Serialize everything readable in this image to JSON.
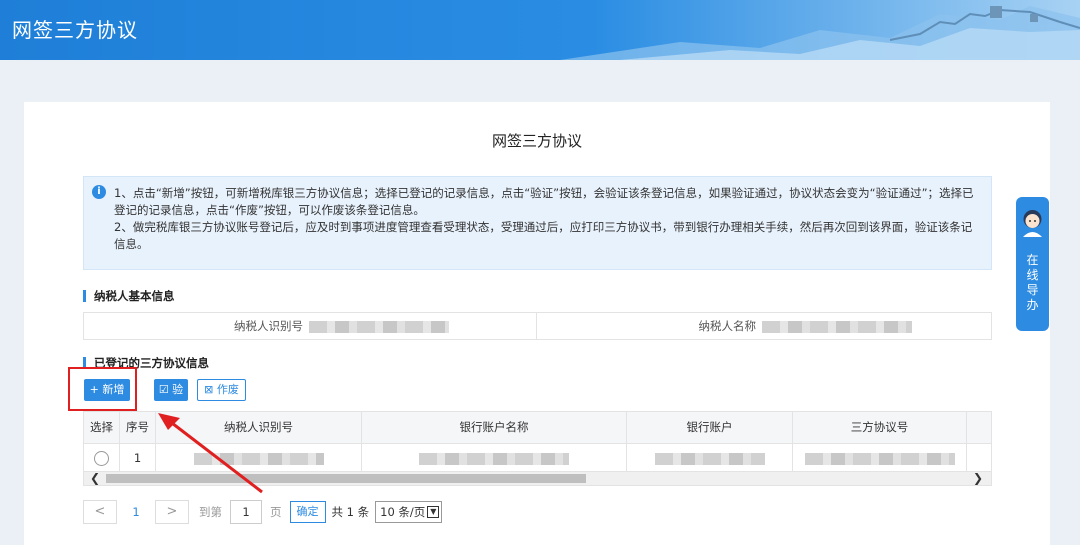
{
  "app": {
    "title": "网签三方协议"
  },
  "page": {
    "heading": "网签三方协议"
  },
  "notice": {
    "line1": "1、点击“新增”按钮，可新增税库银三方协议信息；选择已登记的记录信息，点击“验证”按钮，会验证该条登记信息，如果验证通过，协议状态会变为“验证通过”；选择已登记的记录信息，点击“作废”按钮，可以作废该条登记信息。",
    "line2": "2、做完税库银三方协议账号登记后，应及时到事项进度管理查看受理状态，受理通过后，应打印三方协议书，带到银行办理相关手续，然后再次回到该界面，验证该条记信息。"
  },
  "taxpayer": {
    "section_title": "纳税人基本信息",
    "id_label": "纳税人识别号",
    "name_label": "纳税人名称"
  },
  "agreements": {
    "section_title": "已登记的三方协议信息",
    "add_label": "+ 新增",
    "verify_label": "☑ 验证",
    "void_label": "⊠ 作废",
    "columns": [
      "选择",
      "序号",
      "纳税人识别号",
      "银行账户名称",
      "银行账户",
      "三方协议号"
    ],
    "rows": [
      {
        "index": "1"
      }
    ]
  },
  "pager": {
    "prev": "<",
    "next": ">",
    "current": "1",
    "goto_prefix": "到第",
    "goto_value": "1",
    "goto_suffix": "页",
    "confirm": "确定",
    "total": "共 1 条",
    "page_size": "10 条/页"
  },
  "side_guide": {
    "label": "在线导办"
  },
  "colors": {
    "primary": "#2d8be2",
    "highlight": "#e02020"
  },
  "icons": [
    "info-icon",
    "chevron-down-icon",
    "avatar-icon"
  ]
}
